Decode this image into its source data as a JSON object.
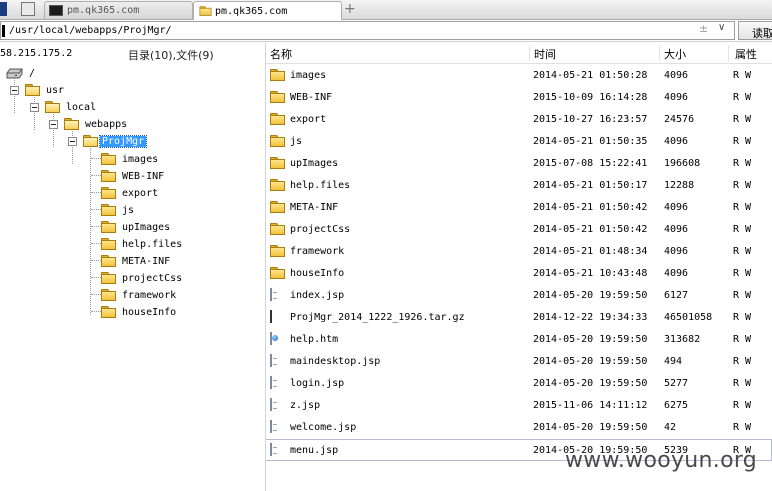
{
  "tabs": [
    {
      "title": "pm.qk365.com",
      "icon": "terminal-icon",
      "active": false
    },
    {
      "title": "pm.qk365.com",
      "icon": "folder-icon",
      "active": true
    }
  ],
  "new_tab_symbol": "+",
  "path_bar": {
    "value": "/usr/local/webapps/ProjMgr/",
    "plus_minus": "±",
    "dropdown": "∨",
    "read_button": "读取"
  },
  "left": {
    "ip": "58.215.175.2",
    "summary": "目录(10),文件(9)",
    "tree": [
      {
        "label": "/",
        "icon": "drive-icon"
      },
      {
        "label": "usr",
        "icon": "folder-icon"
      },
      {
        "label": "local",
        "icon": "folder-icon"
      },
      {
        "label": "webapps",
        "icon": "folder-icon"
      },
      {
        "label": "ProjMgr",
        "icon": "folder-open-icon",
        "selected": true
      },
      {
        "label": "images",
        "icon": "folder-icon"
      },
      {
        "label": "WEB-INF",
        "icon": "folder-icon"
      },
      {
        "label": "export",
        "icon": "folder-icon"
      },
      {
        "label": "js",
        "icon": "folder-icon"
      },
      {
        "label": "upImages",
        "icon": "folder-icon"
      },
      {
        "label": "help.files",
        "icon": "folder-icon"
      },
      {
        "label": "META-INF",
        "icon": "folder-icon"
      },
      {
        "label": "projectCss",
        "icon": "folder-icon"
      },
      {
        "label": "framework",
        "icon": "folder-icon"
      },
      {
        "label": "houseInfo",
        "icon": "folder-icon"
      }
    ]
  },
  "list": {
    "columns": {
      "name": "名称",
      "time": "时间",
      "size": "大小",
      "attr": "属性"
    },
    "rows": [
      {
        "name": "images",
        "time": "2014-05-21 01:50:28",
        "size": "4096",
        "attr": "R W",
        "type": "folder"
      },
      {
        "name": "WEB-INF",
        "time": "2015-10-09 16:14:28",
        "size": "4096",
        "attr": "R W",
        "type": "folder"
      },
      {
        "name": "export",
        "time": "2015-10-27 16:23:57",
        "size": "24576",
        "attr": "R W",
        "type": "folder"
      },
      {
        "name": "js",
        "time": "2014-05-21 01:50:35",
        "size": "4096",
        "attr": "R W",
        "type": "folder"
      },
      {
        "name": "upImages",
        "time": "2015-07-08 15:22:41",
        "size": "196608",
        "attr": "R W",
        "type": "folder"
      },
      {
        "name": "help.files",
        "time": "2014-05-21 01:50:17",
        "size": "12288",
        "attr": "R W",
        "type": "folder"
      },
      {
        "name": "META-INF",
        "time": "2014-05-21 01:50:42",
        "size": "4096",
        "attr": "R W",
        "type": "folder"
      },
      {
        "name": "projectCss",
        "time": "2014-05-21 01:50:42",
        "size": "4096",
        "attr": "R W",
        "type": "folder"
      },
      {
        "name": "framework",
        "time": "2014-05-21 01:48:34",
        "size": "4096",
        "attr": "R W",
        "type": "folder"
      },
      {
        "name": "houseInfo",
        "time": "2014-05-21 10:43:48",
        "size": "4096",
        "attr": "R W",
        "type": "folder"
      },
      {
        "name": "index.jsp",
        "time": "2014-05-20 19:59:50",
        "size": "6127",
        "attr": "R W",
        "type": "file"
      },
      {
        "name": "ProjMgr_2014_1222_1926.tar.gz",
        "time": "2014-12-22 19:34:33",
        "size": "46501058",
        "attr": "R W",
        "type": "archive"
      },
      {
        "name": "help.htm",
        "time": "2014-05-20 19:59:50",
        "size": "313682",
        "attr": "R W",
        "type": "htm"
      },
      {
        "name": "maindesktop.jsp",
        "time": "2014-05-20 19:59:50",
        "size": "494",
        "attr": "R W",
        "type": "file"
      },
      {
        "name": "login.jsp",
        "time": "2014-05-20 19:59:50",
        "size": "5277",
        "attr": "R W",
        "type": "file"
      },
      {
        "name": "z.jsp",
        "time": "2015-11-06 14:11:12",
        "size": "6275",
        "attr": "R W",
        "type": "file"
      },
      {
        "name": "welcome.jsp",
        "time": "2014-05-20 19:59:50",
        "size": "42",
        "attr": "R W",
        "type": "file"
      },
      {
        "name": "menu.jsp",
        "time": "2014-05-20 19:59:50",
        "size": "5239",
        "attr": "R W",
        "type": "file"
      }
    ]
  },
  "watermark": "www.wooyun.org"
}
